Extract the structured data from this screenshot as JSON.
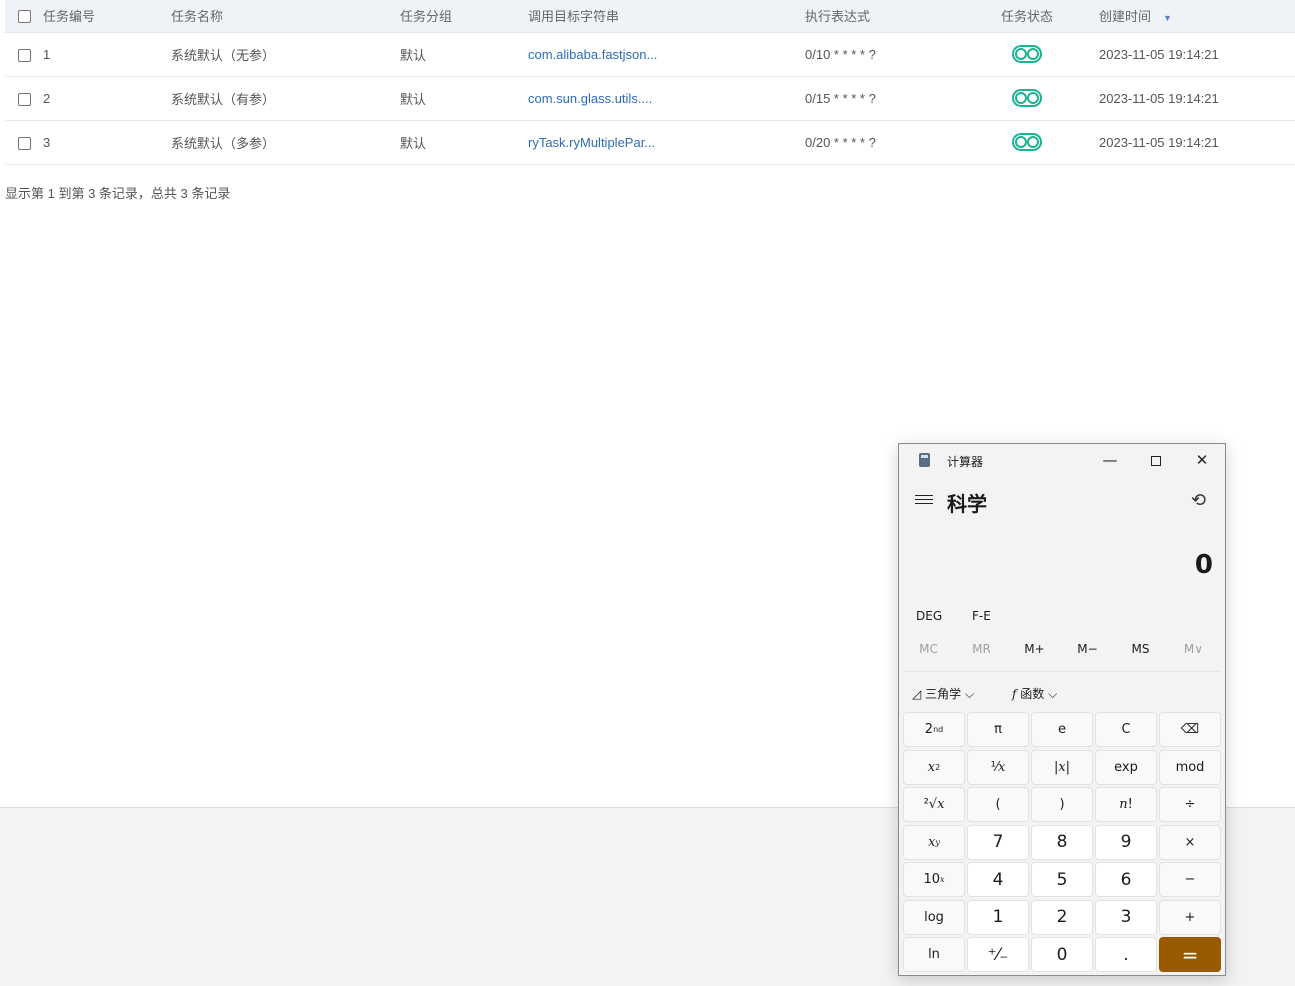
{
  "table": {
    "headers": [
      "任务编号",
      "任务名称",
      "任务分组",
      "调用目标字符串",
      "执行表达式",
      "任务状态",
      "创建时间"
    ],
    "rows": [
      {
        "id": "1",
        "name": "系统默认（无参）",
        "group": "默认",
        "target": "com.alibaba.fastjson...",
        "cron": "0/10 * * * * ?",
        "enabled": true,
        "created": "2023-11-05 19:14:21"
      },
      {
        "id": "2",
        "name": "系统默认（有参）",
        "group": "默认",
        "target": "com.sun.glass.utils....",
        "cron": "0/15 * * * * ?",
        "enabled": true,
        "created": "2023-11-05 19:14:21"
      },
      {
        "id": "3",
        "name": "系统默认（多参）",
        "group": "默认",
        "target": "ryTask.ryMultiplePar...",
        "cron": "0/20 * * * * ?",
        "enabled": true,
        "created": "2023-11-05 19:14:21"
      }
    ],
    "sort_icon": "sort-desc-icon"
  },
  "pagination": {
    "summary": "显示第 1 到第 3 条记录，总共 3 条记录"
  },
  "calculator": {
    "title": "计算器",
    "mode": "科学",
    "display": "0",
    "angle": "DEG",
    "fe": "F-E",
    "memory": [
      {
        "label": "MC",
        "enabled": false
      },
      {
        "label": "MR",
        "enabled": false
      },
      {
        "label": "M+",
        "enabled": true
      },
      {
        "label": "M−",
        "enabled": true
      },
      {
        "label": "MS",
        "enabled": true
      },
      {
        "label": "M∨",
        "enabled": false
      }
    ],
    "trig_label": "三角学",
    "func_label": "函数",
    "accent_color": "#9a5a00"
  }
}
